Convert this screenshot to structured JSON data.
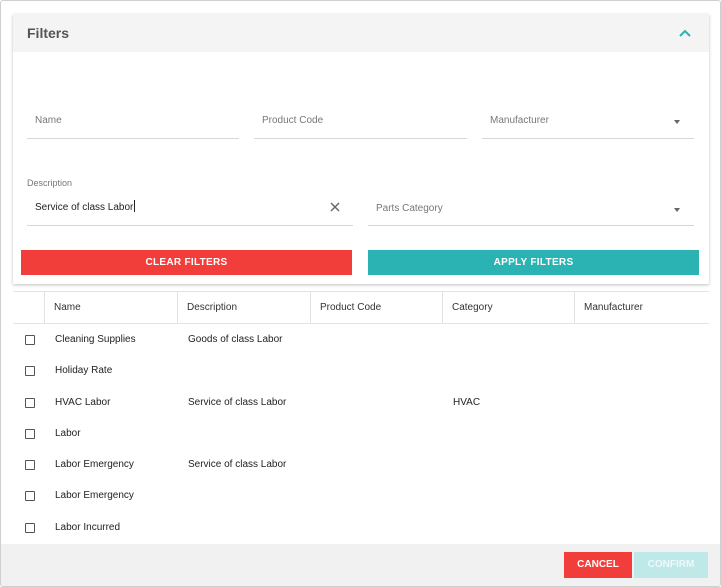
{
  "filters": {
    "title": "Filters",
    "name_placeholder": "Name",
    "product_code_placeholder": "Product Code",
    "manufacturer_placeholder": "Manufacturer",
    "description_label": "Description",
    "description_value": "Service of class Labor",
    "parts_category_placeholder": "Parts Category",
    "clear_label": "CLEAR FILTERS",
    "apply_label": "APPLY FILTERS"
  },
  "table": {
    "columns": [
      "Name",
      "Description",
      "Product Code",
      "Category",
      "Manufacturer"
    ],
    "rows": [
      [
        "Cleaning Supplies",
        "Goods of class Labor",
        "",
        "",
        ""
      ],
      [
        "Holiday Rate",
        "",
        "",
        "",
        ""
      ],
      [
        "HVAC Labor",
        "Service of class Labor",
        "",
        "HVAC",
        ""
      ],
      [
        "Labor",
        "",
        "",
        "",
        ""
      ],
      [
        "Labor Emergency",
        "Service of class Labor",
        "",
        "",
        ""
      ],
      [
        "Labor Emergency",
        "",
        "",
        "",
        ""
      ],
      [
        "Labor Incurred",
        "",
        "",
        "",
        ""
      ]
    ]
  },
  "footer": {
    "cancel_label": "CANCEL",
    "confirm_label": "CONFIRM"
  },
  "colors": {
    "danger": "#f13e3a",
    "accent": "#2bb3b4",
    "accent_disabled": "#bfe8e8"
  },
  "icons": {
    "collapse": "chevron-up-icon",
    "clear": "close-icon",
    "dropdown": "caret-down-icon",
    "row_select": "checkbox-icon"
  }
}
